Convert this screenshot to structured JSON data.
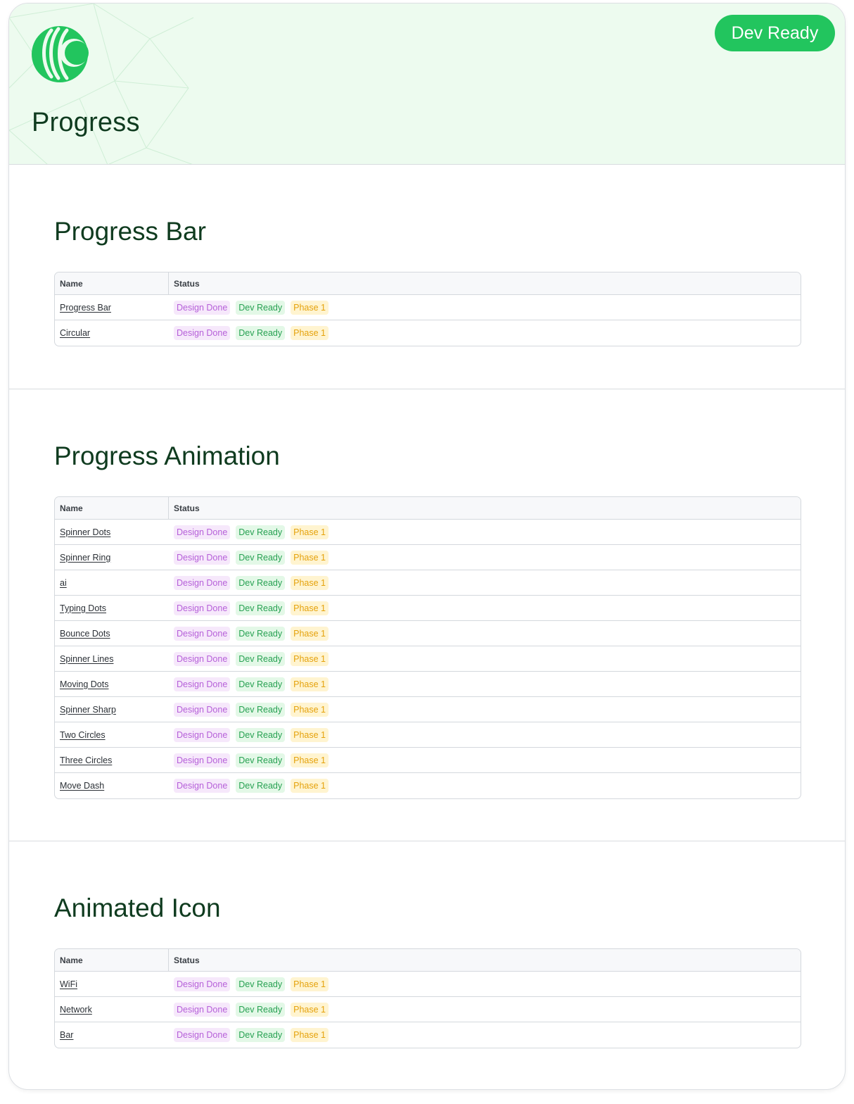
{
  "header": {
    "title": "Progress",
    "status_pill": "Dev Ready",
    "colors": {
      "background": "#edfbef",
      "brand": "#22c55e"
    }
  },
  "table_headers": {
    "name": "Name",
    "status": "Status"
  },
  "tag_labels": {
    "design": "Design Done",
    "dev": "Dev Ready",
    "phase": "Phase 1"
  },
  "tag_colors": {
    "design": "#b660d9",
    "dev": "#27a152",
    "phase": "#e5a20c"
  },
  "sections": [
    {
      "title": "Progress Bar",
      "rows": [
        "Progress Bar",
        "Circular"
      ]
    },
    {
      "title": "Progress Animation",
      "rows": [
        "Spinner Dots",
        "Spinner Ring",
        "ai",
        "Typing Dots",
        "Bounce Dots",
        "Spinner Lines",
        "Moving Dots",
        "Spinner Sharp",
        "Two Circles",
        "Three Circles",
        "Move Dash"
      ]
    },
    {
      "title": "Animated Icon",
      "rows": [
        "WiFi",
        "Network",
        "Bar"
      ]
    }
  ]
}
